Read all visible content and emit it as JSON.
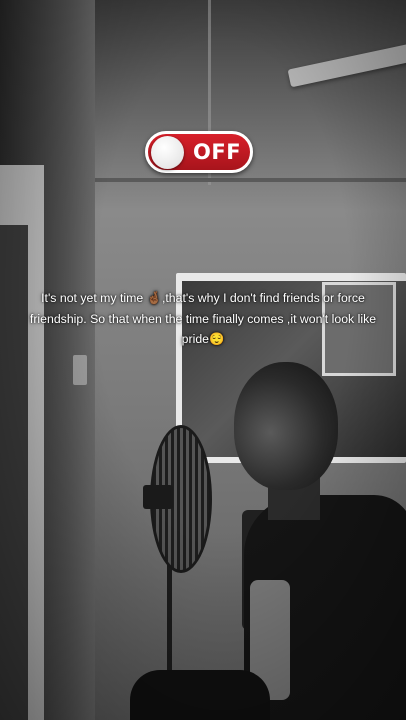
{
  "toggle": {
    "label": "OFF",
    "state": "off",
    "colors": {
      "track": "#c8182a",
      "knob": "#ffffff"
    }
  },
  "caption": {
    "text": "It's not yet my time 🤞🏾,that's why I don't find friends or force friendship. So that when the time finally comes ,it won't look like pride😌"
  }
}
